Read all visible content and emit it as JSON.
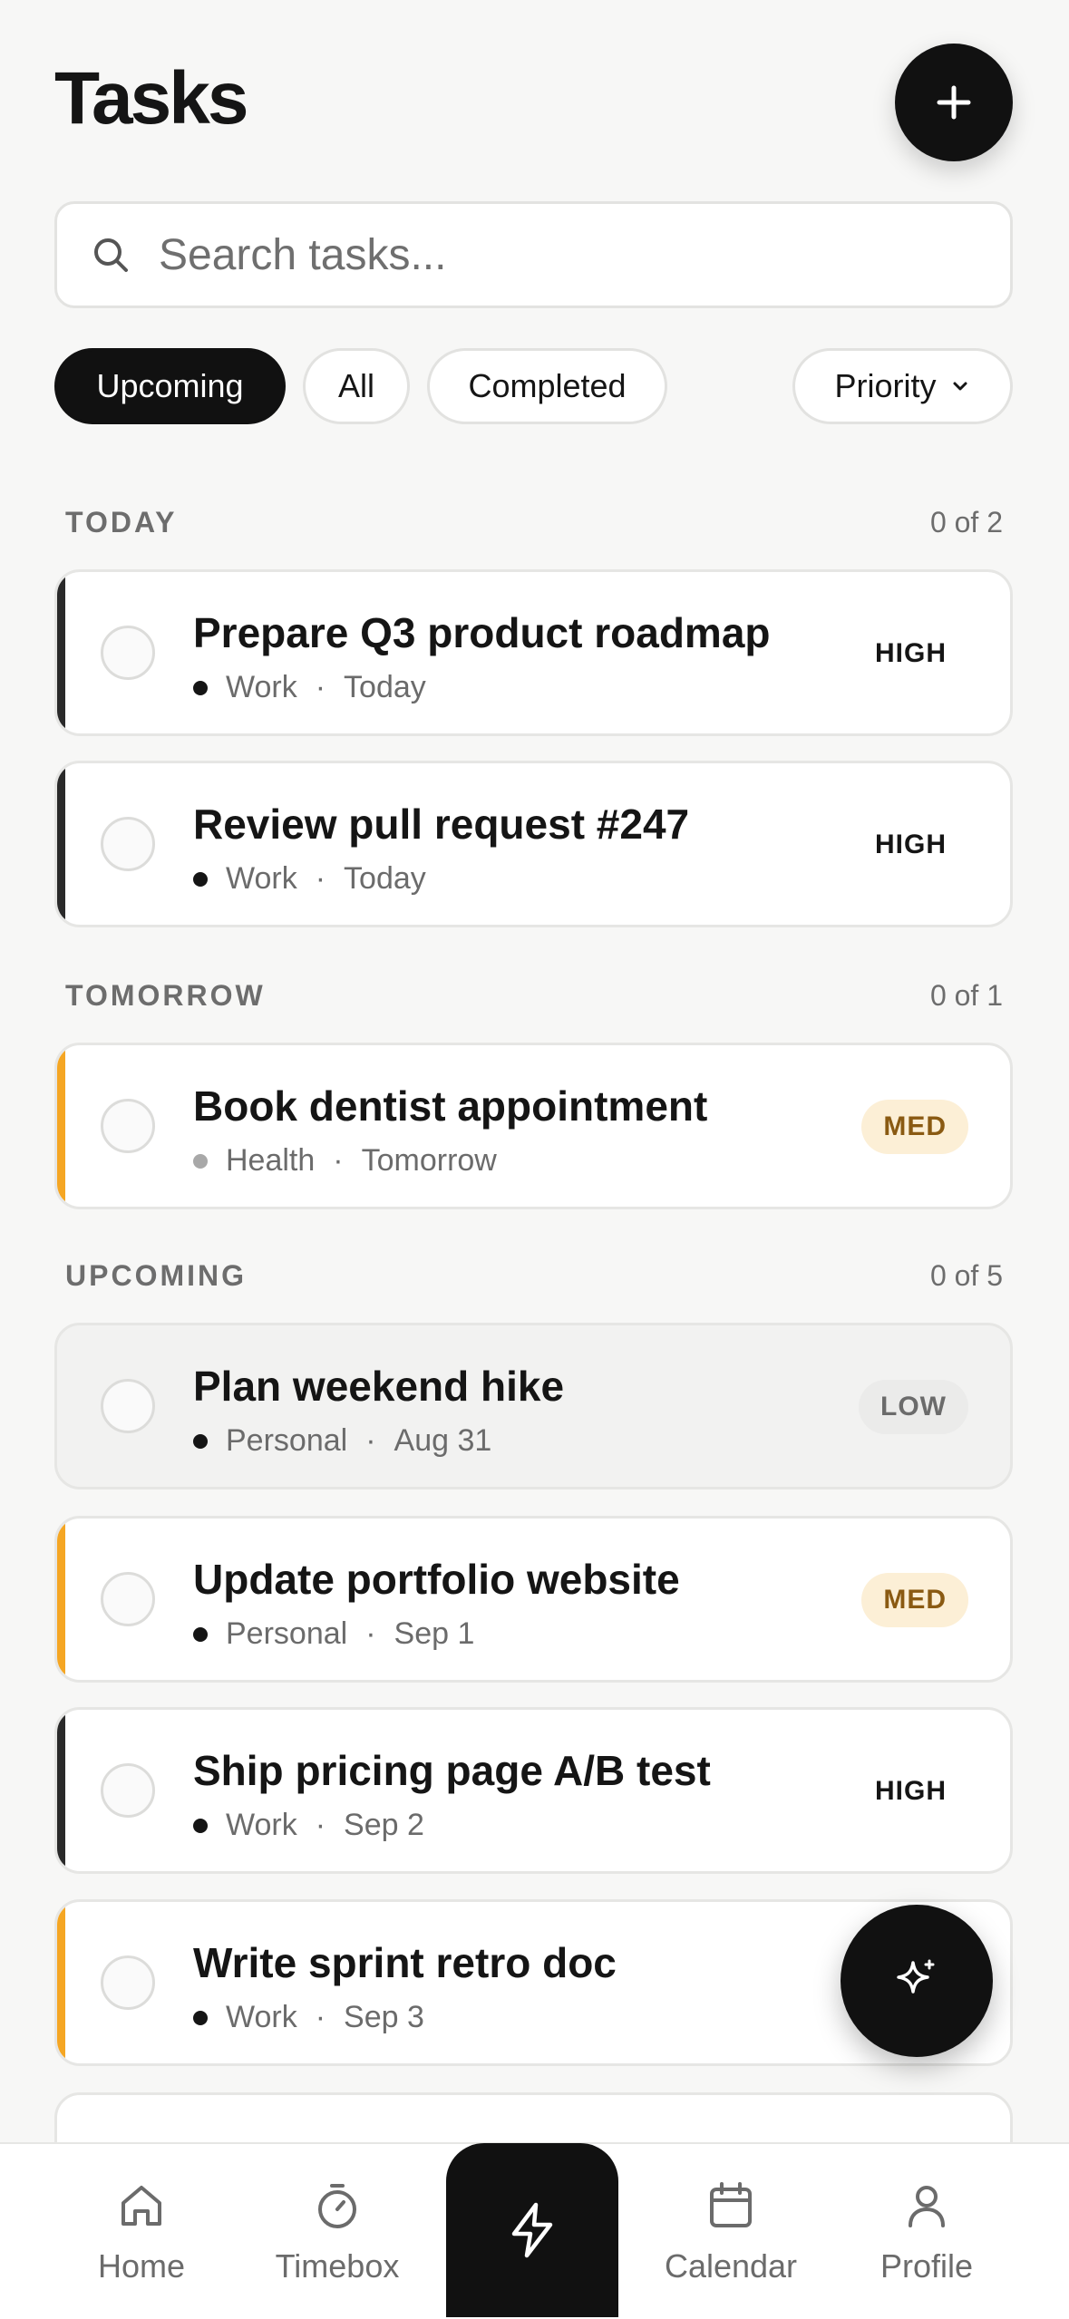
{
  "header": {
    "title": "Tasks"
  },
  "search": {
    "placeholder": "Search tasks..."
  },
  "filters": {
    "upcoming": "Upcoming",
    "all": "All",
    "completed": "Completed",
    "priority": "Priority"
  },
  "sections": [
    {
      "label": "TODAY",
      "count": "0 of 2"
    },
    {
      "label": "TOMORROW",
      "count": "0 of 1"
    },
    {
      "label": "UPCOMING",
      "count": "0 of 5"
    }
  ],
  "tasks": [
    {
      "title": "Prepare Q3 product roadmap",
      "category": "Work",
      "date": "Today",
      "priority": "HIGH"
    },
    {
      "title": "Review pull request #247",
      "category": "Work",
      "date": "Today",
      "priority": "HIGH"
    },
    {
      "title": "Book dentist appointment",
      "category": "Health",
      "date": "Tomorrow",
      "priority": "MED"
    },
    {
      "title": "Plan weekend hike",
      "category": "Personal",
      "date": "Aug 31",
      "priority": "LOW"
    },
    {
      "title": "Update portfolio website",
      "category": "Personal",
      "date": "Sep 1",
      "priority": "MED"
    },
    {
      "title": "Ship pricing page A/B test",
      "category": "Work",
      "date": "Sep 2",
      "priority": "HIGH"
    },
    {
      "title": "Write sprint retro doc",
      "category": "Work",
      "date": "Sep 3",
      "priority": ""
    }
  ],
  "colors": {
    "high": "#2a2a2a",
    "med": "#f5a623",
    "low": "#bdbdbd",
    "accent": "#111111"
  },
  "tabbar": {
    "home": "Home",
    "timebox": "Timebox",
    "calendar": "Calendar",
    "profile": "Profile"
  },
  "icons": {
    "add": "plus-icon",
    "search": "search-icon",
    "chevron": "chevron-down-icon",
    "sparkle": "sparkle-icon",
    "quick": "lightning-icon",
    "home": "home-icon",
    "timebox": "stopwatch-icon",
    "calendar": "calendar-icon",
    "profile": "user-icon"
  }
}
